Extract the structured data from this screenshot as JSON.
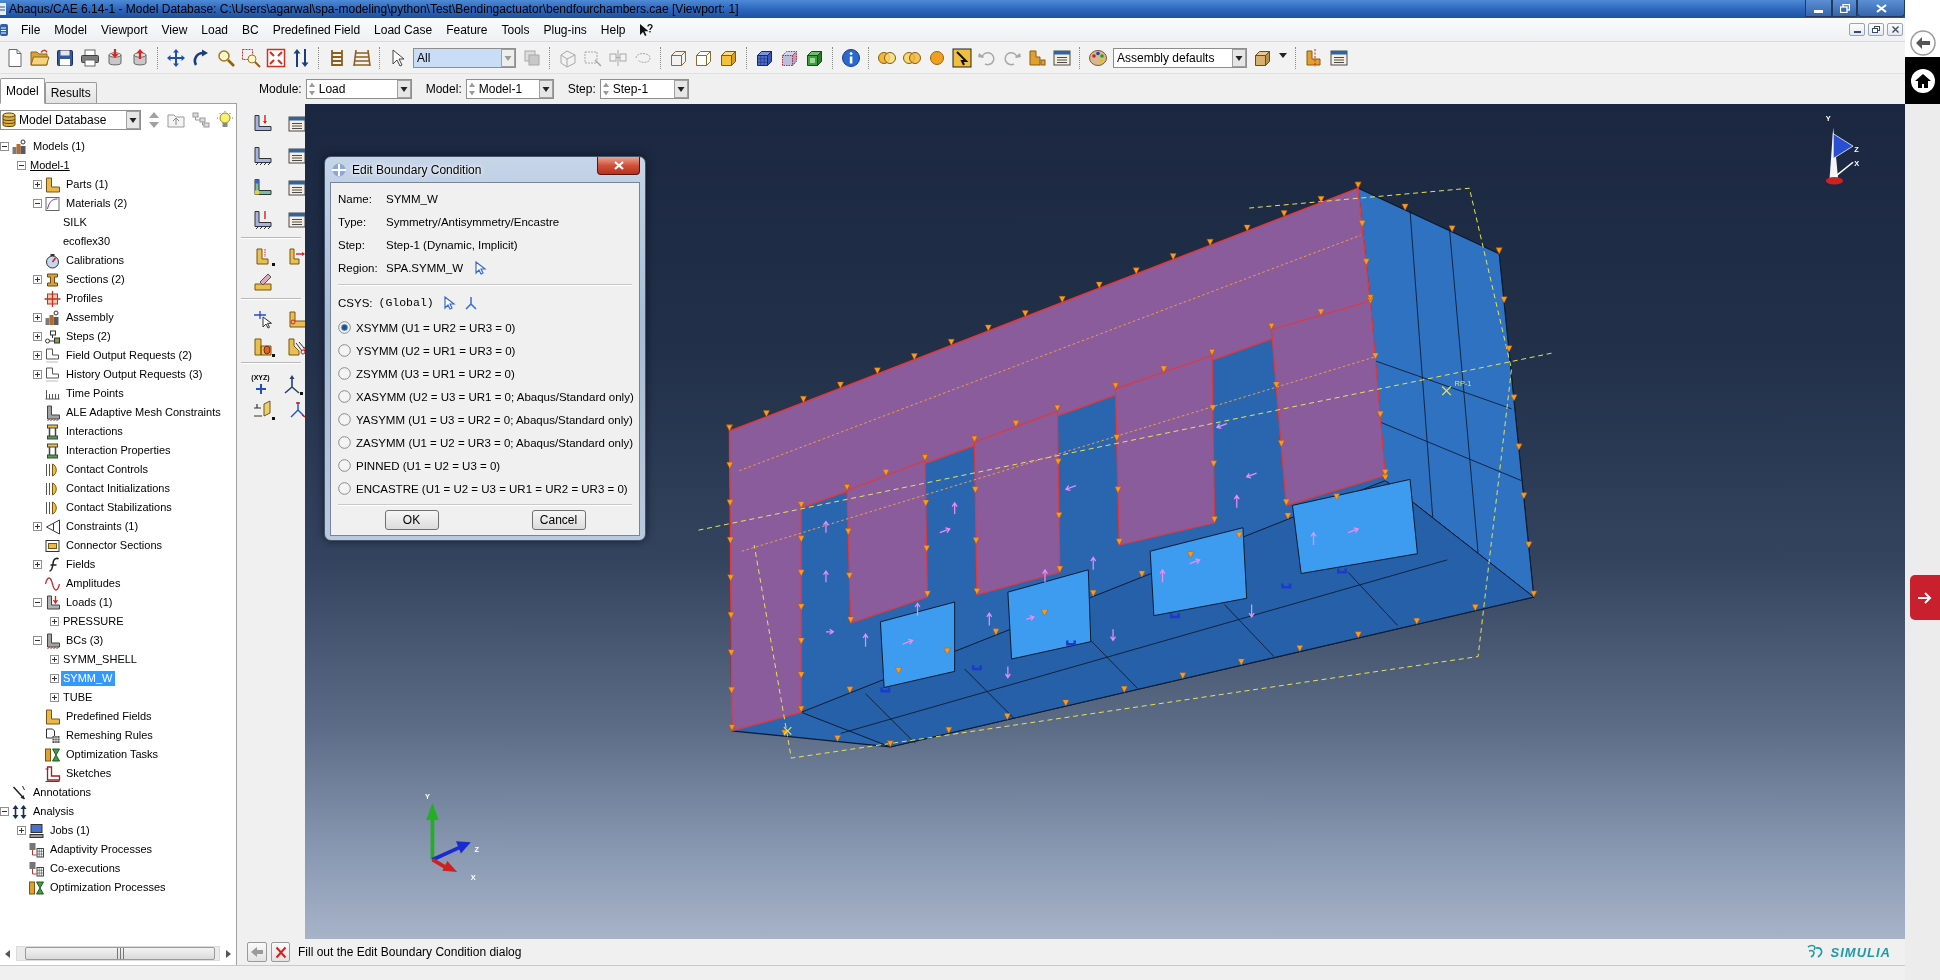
{
  "window": {
    "title": "Abaqus/CAE 6.14-1 - Model Database: C:\\Users\\agarwal\\spa-modeling\\python\\Test\\Bendingactuator\\bendfourchambers.cae [Viewport: 1]"
  },
  "menu": [
    "File",
    "Model",
    "Viewport",
    "View",
    "Load",
    "BC",
    "Predefined Field",
    "Load Case",
    "Feature",
    "Tools",
    "Plug-ins",
    "Help"
  ],
  "toolbar": {
    "selection_filter": "All",
    "render_style": "Assembly defaults"
  },
  "tabs": [
    {
      "label": "Model",
      "selected": true
    },
    {
      "label": "Results",
      "selected": false
    }
  ],
  "context_bar": [
    {
      "label": "Module:",
      "value": "Load"
    },
    {
      "label": "Model:",
      "value": "Model-1"
    },
    {
      "label": "Step:",
      "value": "Step-1"
    }
  ],
  "model_tree": {
    "source": "Model Database",
    "items": [
      {
        "label": "Models (1)",
        "kind": "blocks",
        "expanded": true,
        "selected": false,
        "children": [
          {
            "label": "Model-1",
            "kind": "model",
            "expanded": true,
            "selected": false,
            "children": [
              {
                "label": "Parts (1)",
                "kind": "bracket",
                "expanded": false,
                "selected": false
              },
              {
                "label": "Materials (2)",
                "kind": "chart",
                "expanded": true,
                "selected": false,
                "children": [
                  {
                    "label": "SILK",
                    "selected": false
                  },
                  {
                    "label": "ecoflex30",
                    "selected": false
                  }
                ]
              },
              {
                "label": "Calibrations",
                "kind": "gauge",
                "selected": false
              },
              {
                "label": "Sections (2)",
                "kind": "beam",
                "expanded": false,
                "selected": false
              },
              {
                "label": "Profiles",
                "kind": "crosshair",
                "selected": false
              },
              {
                "label": "Assembly",
                "kind": "blocks",
                "expanded": false,
                "selected": false
              },
              {
                "label": "Steps (2)",
                "kind": "flow",
                "expanded": false,
                "selected": false
              },
              {
                "label": "Field Output Requests (2)",
                "kind": "table",
                "expanded": false,
                "selected": false
              },
              {
                "label": "History Output Requests (3)",
                "kind": "table",
                "expanded": false,
                "selected": false
              },
              {
                "label": "Time Points",
                "kind": "timeline",
                "selected": false
              },
              {
                "label": "ALE Adaptive Mesh Constraints",
                "kind": "support",
                "selected": false
              },
              {
                "label": "Interactions",
                "kind": "clamp",
                "selected": false
              },
              {
                "label": "Interaction Properties",
                "kind": "clamp",
                "selected": false
              },
              {
                "label": "Contact Controls",
                "kind": "contact",
                "selected": false
              },
              {
                "label": "Contact Initializations",
                "kind": "contact",
                "selected": false
              },
              {
                "label": "Contact Stabilizations",
                "kind": "contact",
                "selected": false
              },
              {
                "label": "Constraints (1)",
                "kind": "triangle",
                "expanded": false,
                "selected": false
              },
              {
                "label": "Connector Sections",
                "kind": "connector",
                "selected": false
              },
              {
                "label": "Fields",
                "kind": "script",
                "expanded": false,
                "selected": false
              },
              {
                "label": "Amplitudes",
                "kind": "wave",
                "selected": false
              },
              {
                "label": "Loads (1)",
                "kind": "load",
                "expanded": true,
                "selected": false,
                "children": [
                  {
                    "label": "PRESSURE",
                    "expanded": false,
                    "selected": false
                  }
                ]
              },
              {
                "label": "BCs (3)",
                "kind": "support",
                "expanded": true,
                "selected": false,
                "children": [
                  {
                    "label": "SYMM_SHELL",
                    "expanded": false,
                    "selected": false
                  },
                  {
                    "label": "SYMM_W",
                    "expanded": false,
                    "selected": true
                  },
                  {
                    "label": "TUBE",
                    "expanded": false,
                    "selected": false
                  }
                ]
              },
              {
                "label": "Predefined Fields",
                "kind": "bracket",
                "selected": false
              },
              {
                "label": "Remeshing Rules",
                "kind": "document",
                "selected": false
              },
              {
                "label": "Optimization Tasks",
                "kind": "hourglass",
                "selected": false
              },
              {
                "label": "Sketches",
                "kind": "sketch",
                "selected": false
              }
            ]
          }
        ]
      },
      {
        "label": "Annotations",
        "kind": "pen",
        "selected": false
      },
      {
        "label": "Analysis",
        "kind": "arrows",
        "expanded": true,
        "selected": false,
        "children": [
          {
            "label": "Jobs (1)",
            "kind": "computer",
            "expanded": false,
            "selected": false
          },
          {
            "label": "Adaptivity Processes",
            "kind": "grid",
            "selected": false
          },
          {
            "label": "Co-executions",
            "kind": "grid",
            "selected": false
          },
          {
            "label": "Optimization Processes",
            "kind": "hourglass",
            "selected": false
          }
        ]
      }
    ]
  },
  "toolbox": {
    "point_tool_caption": "(XYZ)"
  },
  "viewport": {
    "reference_point_label": "RP-1",
    "view_triad": {
      "y": "Y",
      "z": "Z",
      "x": "X"
    },
    "axis_triad": {
      "y": "Y",
      "z": "Z",
      "x": "X"
    }
  },
  "dialog": {
    "title": "Edit Boundary Condition",
    "fields": [
      {
        "label": "Name:",
        "value": "SYMM_W",
        "kind": "text"
      },
      {
        "label": "Type:",
        "value": "Symmetry/Antisymmetry/Encastre",
        "kind": "text"
      },
      {
        "label": "Step:",
        "value": "Step-1 (Dynamic, Implicit)",
        "kind": "text"
      },
      {
        "label": "Region:",
        "value": "SPA.SYMM_W",
        "kind": "pick"
      }
    ],
    "csys": {
      "label": "CSYS:",
      "value": "(Global)"
    },
    "options": [
      {
        "label": "XSYMM (U1 = UR2 = UR3 = 0)",
        "selected": true
      },
      {
        "label": "YSYMM (U2 = UR1 = UR3 = 0)",
        "selected": false
      },
      {
        "label": "ZSYMM (U3 = UR1 = UR2 = 0)",
        "selected": false
      },
      {
        "label": "XASYMM (U2 = U3 = UR1 = 0; Abaqus/Standard only)",
        "selected": false
      },
      {
        "label": "YASYMM (U1 = U3 = UR2 = 0; Abaqus/Standard only)",
        "selected": false
      },
      {
        "label": "ZASYMM (U1 = U2 = UR3 = 0; Abaqus/Standard only)",
        "selected": false
      },
      {
        "label": "PINNED (U1 = U2 = U3 = 0)",
        "selected": false
      },
      {
        "label": "ENCASTRE (U1 = U2 = U3 = UR1 = UR2 = UR3 = 0)",
        "selected": false
      }
    ],
    "buttons": [
      "OK",
      "Cancel"
    ]
  },
  "status_bar": {
    "prompt": "Fill out the Edit Boundary Condition dialog",
    "brand": "SIMULIA"
  }
}
